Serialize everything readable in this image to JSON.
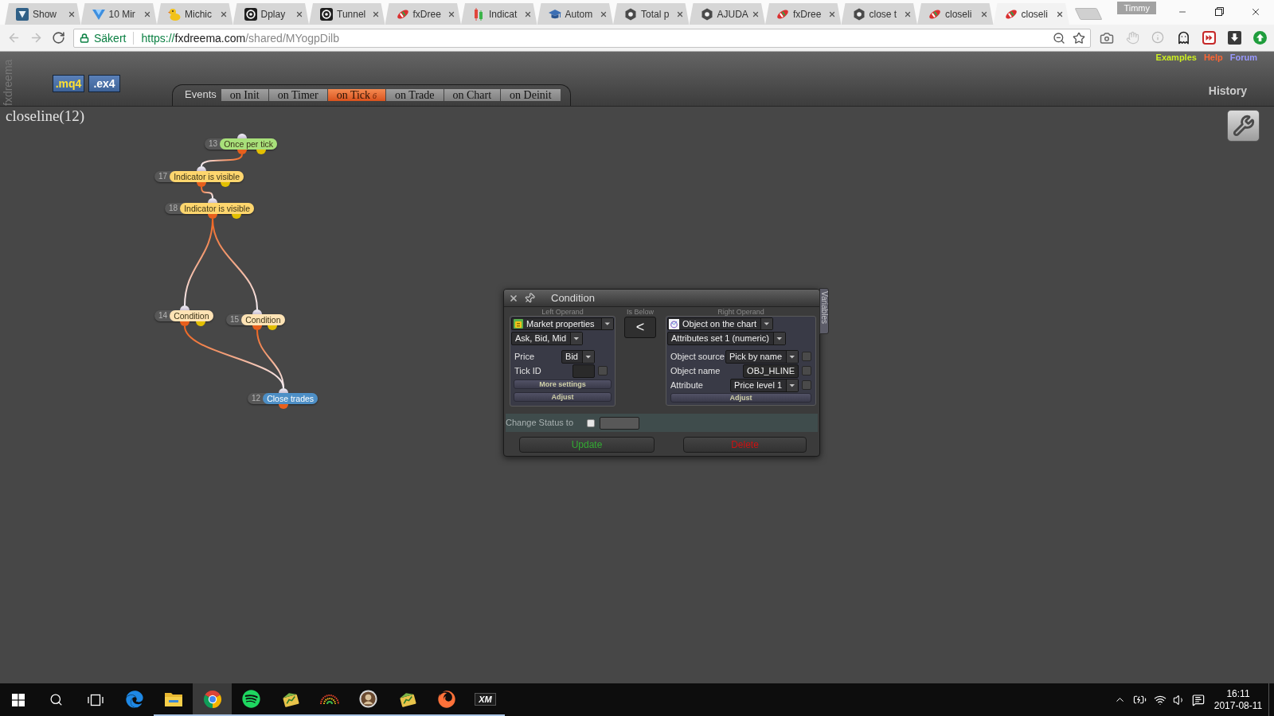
{
  "browser": {
    "tabs": [
      {
        "title": "Show",
        "kind": "tile",
        "selected": false
      },
      {
        "title": "10 Mir",
        "kind": "triangle",
        "selected": false
      },
      {
        "title": "Michic",
        "kind": "duck",
        "selected": false
      },
      {
        "title": "Dplay",
        "kind": "disc",
        "selected": false
      },
      {
        "title": "Tunnel",
        "kind": "disc",
        "selected": false
      },
      {
        "title": "fxDree",
        "kind": "fish",
        "selected": false
      },
      {
        "title": "Indicat",
        "kind": "candles",
        "selected": false
      },
      {
        "title": "Autom",
        "kind": "cap",
        "selected": false
      },
      {
        "title": "Total p",
        "kind": "hexagon",
        "selected": false
      },
      {
        "title": "AJUDA",
        "kind": "hexagon",
        "selected": false
      },
      {
        "title": "fxDree",
        "kind": "fish",
        "selected": false
      },
      {
        "title": "close t",
        "kind": "hexagon",
        "selected": false
      },
      {
        "title": "closeli",
        "kind": "fish",
        "selected": false
      },
      {
        "title": "closeli",
        "kind": "fish",
        "selected": true
      }
    ],
    "profile": "Timmy",
    "navigation": [
      {
        "kind": "back",
        "disabled": true
      },
      {
        "kind": "forward",
        "disabled": true
      },
      {
        "kind": "reload",
        "disabled": false
      }
    ],
    "address_bar": {
      "security_label": "Säkert",
      "scheme": "https://",
      "host": "fxdreema.com",
      "path": "/shared/MYogpDilb"
    }
  },
  "page": {
    "brand": "fxdreema",
    "export_buttons": [
      {
        "label": ".mq4",
        "kind": "accent"
      },
      {
        "label": ".ex4",
        "kind": "plain"
      }
    ],
    "top_links": [
      {
        "label": "Examples",
        "color": "#ccee22"
      },
      {
        "label": "Help",
        "color": "#ff6633"
      },
      {
        "label": "Forum",
        "color": "#9999ff"
      }
    ],
    "events_label": "Events",
    "event_tabs": [
      {
        "label": "on Init",
        "selected": false
      },
      {
        "label": "on Timer",
        "selected": false
      },
      {
        "label": "on Tick",
        "selected": true,
        "badge": "6"
      },
      {
        "label": "on Trade",
        "selected": false
      },
      {
        "label": "on Chart",
        "selected": false
      },
      {
        "label": "on Deinit",
        "selected": false
      }
    ],
    "history_label": "History",
    "project_title": "closeline(12)",
    "nodes": [
      {
        "number": "13",
        "label": "Once per tick",
        "kind": "condition",
        "color": "#a8e07a"
      },
      {
        "number": "17",
        "label": "Indicator is visible",
        "kind": "condition",
        "color": "#ffd66e"
      },
      {
        "number": "18",
        "label": "Indicator is visible",
        "kind": "condition",
        "color": "#ffd66e"
      },
      {
        "number": "14",
        "label": "Condition",
        "kind": "condition",
        "color": "#ffe3b5"
      },
      {
        "number": "15",
        "label": "Condition",
        "kind": "condition",
        "color": "#ffe3b5"
      },
      {
        "number": "12",
        "label": "Close trades",
        "kind": "action",
        "color": "#4d8fc6"
      }
    ]
  },
  "condition_dialog": {
    "title": "Condition",
    "side_tab": "Variables",
    "left_operand": {
      "heading": "Left Operand",
      "source": "Market properties",
      "group": "Ask, Bid, Mid",
      "fields": [
        {
          "kind": "select",
          "label": "Price",
          "value": "Bid"
        },
        {
          "kind": "input",
          "label": "Tick ID",
          "checked": false
        }
      ],
      "buttons": [
        "More settings",
        "Adjust"
      ]
    },
    "operator": {
      "heading": "Is Below",
      "symbol": "<"
    },
    "right_operand": {
      "heading": "Right Operand",
      "source": "Object on the chart",
      "group": "Attributes set 1 (numeric)",
      "fields": [
        {
          "kind": "select",
          "label": "Object source",
          "value": "Pick by name",
          "checked": false
        },
        {
          "kind": "input",
          "label": "Object name",
          "value": "OBJ_HLINE",
          "checked": false
        },
        {
          "kind": "select",
          "label": "Attribute",
          "value": "Price level 1",
          "checked": false
        }
      ],
      "buttons": [
        "Adjust"
      ]
    },
    "status_row": {
      "label": "Change Status to",
      "checked": false
    },
    "actions": [
      {
        "label": "Update",
        "color": "#33aa33"
      },
      {
        "label": "Delete",
        "color": "#cc1111"
      }
    ]
  },
  "taskbar": {
    "apps": [
      {
        "kind": "edge",
        "running": false,
        "selected": false
      },
      {
        "kind": "folder",
        "running": true,
        "selected": false
      },
      {
        "kind": "chrome",
        "running": true,
        "selected": true
      },
      {
        "kind": "spotify",
        "running": true,
        "selected": false
      },
      {
        "kind": "terminal",
        "running": true,
        "selected": false
      },
      {
        "kind": "waves",
        "running": true,
        "selected": false
      },
      {
        "kind": "badge",
        "running": true,
        "selected": false
      },
      {
        "kind": "terminal",
        "running": true,
        "selected": false
      },
      {
        "kind": "firefox",
        "running": true,
        "selected": false
      },
      {
        "kind": "tile",
        "label": "XM",
        "running": true,
        "selected": false
      }
    ],
    "clock": {
      "time": "16:11",
      "date": "2017-08-11"
    }
  }
}
